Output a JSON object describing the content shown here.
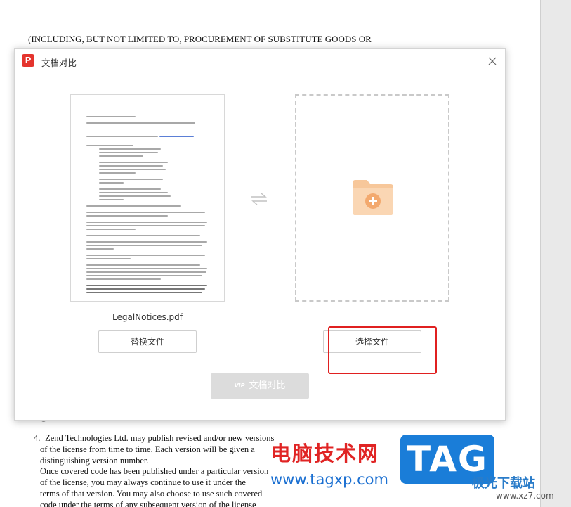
{
  "document": {
    "top_line": "(INCLUDING, BUT NOT LIMITED TO, PROCUREMENT OF SUBSTITUTE GOODS OR",
    "item_number": "4.",
    "lines": [
      "Zend Technologies Ltd. may publish revised and/or new versions",
      "of the license from time to time. Each version will be given a",
      "distinguishing version number.",
      "Once covered code has been published under a particular version",
      "of the license, you may always continue to use it under the",
      "terms of that version. You may also choose to use such covered",
      "code under the terms of any subsequent version of the license"
    ]
  },
  "dialog": {
    "logo": "P",
    "title": "文档对比",
    "left_file_name": "LegalNotices.pdf",
    "replace_label": "替换文件",
    "select_label": "选择文件",
    "vip_label": "VIP",
    "compare_label": "文档对比"
  },
  "watermark": {
    "cn_text": "电脑技术网",
    "url": "www.tagxp.com",
    "tag_logo": "TAG",
    "site_name": "极光下载站",
    "site_url": "www.xz7.com"
  },
  "colors": {
    "highlight_box": "#e02020",
    "folder": "#f7c79a",
    "folder_plus_circle": "#f3a96e",
    "compare_disabled": "#dcdcdc"
  }
}
